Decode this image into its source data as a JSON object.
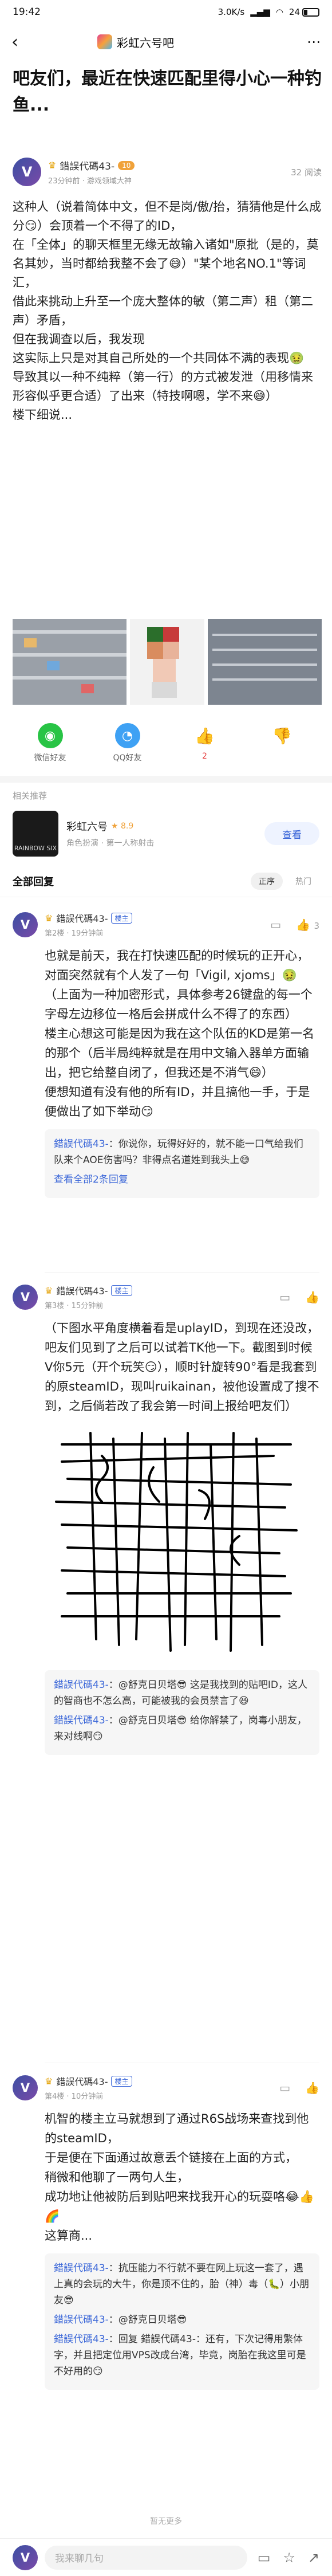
{
  "status_bar": {
    "time": "19:42",
    "network_speed": "3.0K/s",
    "battery": "24",
    "battery_level": 0.24
  },
  "nav": {
    "forum_name": "彩虹六号吧"
  },
  "post": {
    "title": "吧友们，最近在快速匹配里得小心一种钓鱼...",
    "author": {
      "name": "錯誤代碼43-",
      "avatar_letter": "V",
      "level": "10",
      "sub": "23分钟前 · 游戏领域大神"
    },
    "views": "32 阅读",
    "paragraphs": [
      "这种人（说着简体中文，但不是岗/傲/抬，猜猜他是什么成分😏）会顶着一个不得了的ID，",
      "在「全体」的聊天框里无缘无故输入诸如\"原批（是的，莫名其妙，当时都给我整不会了😅）\"某个地名NO.1\"等词汇，",
      "借此来挑动上升至一个庞大整体的敏（第二声）租（第二声）矛盾，",
      "但在我调查以后，我发现",
      "这实际上只是对其自己所处的一个共同体不满的表现🤢",
      "导致其以一种不纯粹（第一行）的方式被发泄（用移情来形容似乎更合适）了出来（特技啊嗯，学不来😅）",
      "楼下细说..."
    ]
  },
  "share": {
    "wechat": "微信好友",
    "qq": "QQ好友",
    "like_count": "2"
  },
  "related": {
    "label": "相关推荐",
    "forum_name": "彩虹六号",
    "rating": "★ 8.9",
    "desc": "角色扮演 · 第一人称射击",
    "thumb_text": "RAINBOW SIX",
    "view_label": "查看"
  },
  "replies": {
    "title": "全部回复",
    "sort_options": [
      "正序",
      "热门"
    ],
    "floors": [
      {
        "author": "錯誤代碼43-",
        "avatar_letter": "V",
        "op_label": "楼主",
        "sub": "第2楼 · 19分钟前",
        "likes": "3",
        "paragraphs": [
          "也就是前天，我在打快速匹配的时候玩的正开心，对面突然就有个人发了一句「Vigil, xjoms」🤢",
          "（上面为一种加密形式，具体参考26键盘的每一个字母左边移位一格后会拼成什么不得了的东西）",
          "楼主心想这可能是因为我在这个队伍的KD是第一名的那个（后半局纯粹就是在用中文输入器单方面输出，把它给整自闭了，但我还是不消气😄）",
          "便想知道有没有他的所有ID，并且搞他一手，于是便做出了如下举动😏"
        ],
        "sub_replies": [
          {
            "name": "錯誤代碼43-",
            "text": "：你说你，玩得好好的，就不能一口气给我们队来个AOE伤害吗？非得点名道姓到我头上😅"
          }
        ],
        "more": "查看全部2条回复"
      },
      {
        "author": "錯誤代碼43-",
        "avatar_letter": "V",
        "op_label": "楼主",
        "sub": "第3楼 · 15分钟前",
        "likes": "",
        "paragraphs": [
          "（下图水平角度横着看是uplayID，到现在还没改，吧友们见到了之后可以试着TK他一下。截图到时候V你5元（开个玩笑😏），顺时针旋转90°看是我套到的原steamID，现叫ruikainan，被他设置成了搜不到，之后倘若改了我会第一时间上报给吧友们）"
        ],
        "sub_replies": [
          {
            "name": "錯誤代碼43-",
            "text": "：@舒克日贝塔😎 这是我找到的贴吧ID，这人的智商也不怎么高，可能被我的会员禁言了😆"
          },
          {
            "name": "錯誤代碼43-",
            "text": "：@舒克日贝塔😎 给你解禁了，岗毒小朋友，来对线啊😏"
          }
        ],
        "more": ""
      },
      {
        "author": "錯誤代碼43-",
        "avatar_letter": "V",
        "op_label": "楼主",
        "sub": "第4楼 · 10分钟前",
        "likes": "",
        "paragraphs": [
          "机智的楼主立马就想到了通过R6S战场来查找到他的steamID，",
          "于是便在下面通过故意丢个链接在上面的方式，",
          "稍微和他聊了一两句人生，",
          "成功地让他被防后到贴吧来找我开心的玩耍咯😂👍🌈",
          "这算商..."
        ],
        "sub_replies": [
          {
            "name": "錯誤代碼43-",
            "text": "：抗压能力不行就不要在网上玩这一套了，遇上真的会玩的大牛，你是顶不住的，胎（神）毒（🐛）小朋友😎"
          },
          {
            "name": "錯誤代碼43-",
            "text": "：@舒克日贝塔😎"
          },
          {
            "name": "錯誤代碼43-",
            "text": "：回复 錯誤代碼43-：还有，下次记得用繁体字，并且把定位用VPS改成台湾，毕竟，岗胎在我这里可是不好用的😏"
          }
        ],
        "more": ""
      }
    ],
    "fold_note": "暂无更多"
  },
  "input": {
    "placeholder": "我来聊几句"
  }
}
